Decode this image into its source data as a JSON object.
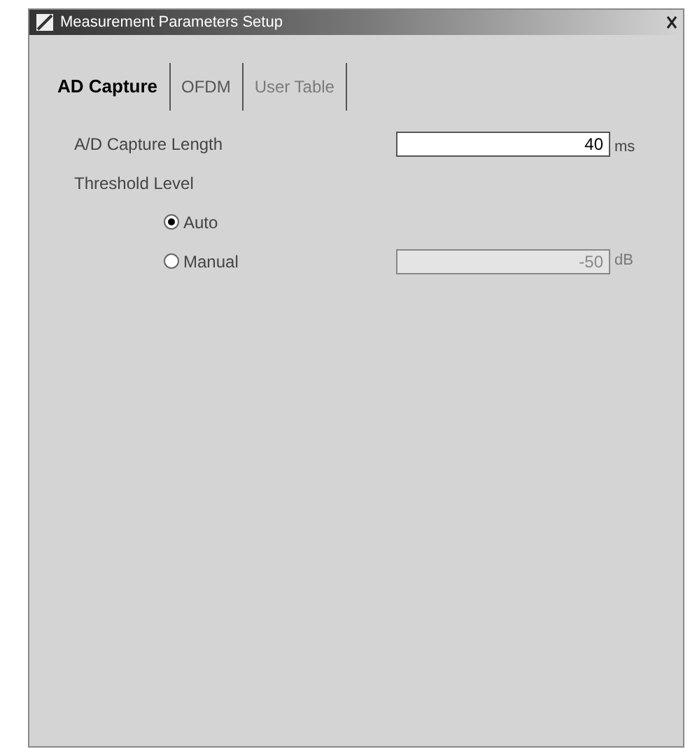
{
  "window": {
    "title": "Measurement Parameters Setup"
  },
  "tabs": [
    {
      "label": "AD Capture",
      "selected": true,
      "disabled": false
    },
    {
      "label": "OFDM",
      "selected": false,
      "disabled": false
    },
    {
      "label": "User Table",
      "selected": false,
      "disabled": true
    }
  ],
  "capture_length": {
    "label": "A/D Capture Length",
    "value": "40",
    "unit": "ms"
  },
  "threshold": {
    "label": "Threshold Level",
    "options": [
      {
        "label": "Auto",
        "selected": true
      },
      {
        "label": "Manual",
        "selected": false,
        "field": {
          "value": "-50",
          "unit": "dB",
          "disabled": true
        }
      }
    ]
  }
}
